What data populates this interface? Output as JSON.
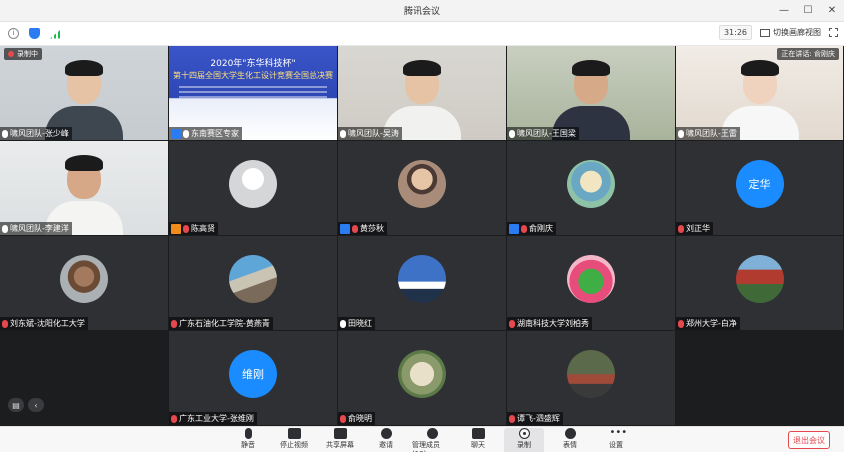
{
  "app": {
    "title": "腾讯会议"
  },
  "infobar": {
    "timer": "31:26",
    "view_label": "切换画廊视图"
  },
  "stage": {
    "recording_label": "录制中",
    "speaking_label": "正在讲话: 俞刚庆"
  },
  "slide": {
    "title": "2020年\"东华科技杯\"",
    "subtitle": "第十四届全国大学生化工设计竞赛全国总决赛"
  },
  "participants": [
    {
      "name": "啸风团队-张少峰",
      "type": "video"
    },
    {
      "name": "东南赛区专家",
      "type": "slide"
    },
    {
      "name": "啸风团队-吴涛",
      "type": "video"
    },
    {
      "name": "啸风团队-王国梁",
      "type": "video"
    },
    {
      "name": "啸风团队-王雷",
      "type": "video"
    },
    {
      "name": "啸风团队-李建洋",
      "type": "video"
    },
    {
      "name": "陈高贤",
      "type": "avatar"
    },
    {
      "name": "黄莎秋",
      "type": "avatar"
    },
    {
      "name": "俞刚庆",
      "type": "avatar"
    },
    {
      "name": "刘正华",
      "type": "avatar",
      "initials": "定华"
    },
    {
      "name": "刘东斌-沈阳化工大学",
      "type": "avatar"
    },
    {
      "name": "广东石油化工学院-黄燕青",
      "type": "avatar"
    },
    {
      "name": "田晓红",
      "type": "avatar"
    },
    {
      "name": "湖南科技大学刘柏秀",
      "type": "avatar"
    },
    {
      "name": "郑州大学-白净",
      "type": "avatar"
    },
    {
      "name": "",
      "type": "empty"
    },
    {
      "name": "广东工业大学-张维刚",
      "type": "avatar",
      "initials": "维刚"
    },
    {
      "name": "俞晓明",
      "type": "avatar"
    },
    {
      "name": "谭飞-泗盛辉",
      "type": "avatar"
    },
    {
      "name": "",
      "type": "empty"
    }
  ],
  "toolbar": {
    "items": [
      "静音",
      "停止视频",
      "共享屏幕",
      "邀请",
      "管理成员(18)",
      "聊天",
      "录制",
      "表情",
      "设置"
    ],
    "end_label": "退出会议"
  }
}
